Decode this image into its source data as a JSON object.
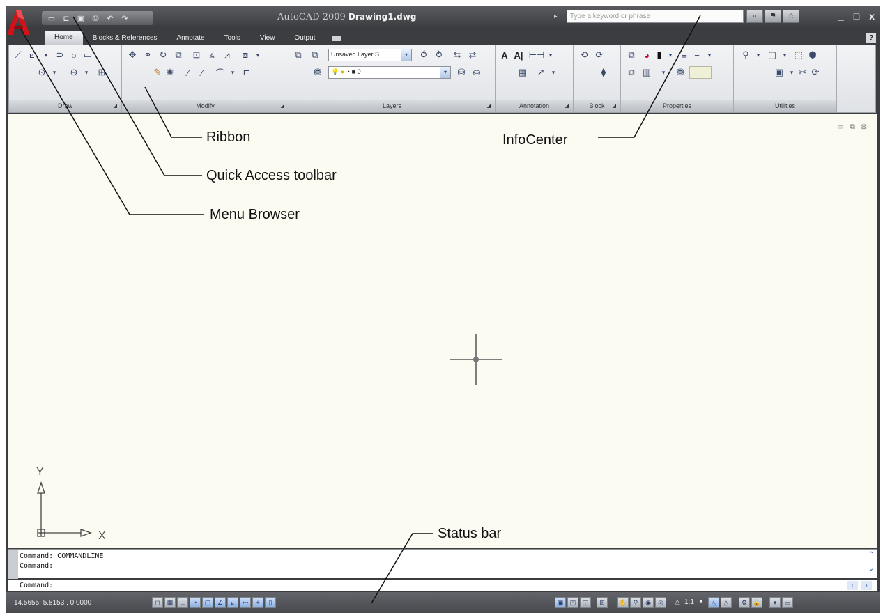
{
  "titlebar": {
    "app_name": "AutoCAD 2009",
    "doc_name": "Drawing1.dwg",
    "search_placeholder": "Type a keyword or phrase"
  },
  "tabs": [
    "Home",
    "Blocks & References",
    "Annotate",
    "Tools",
    "View",
    "Output"
  ],
  "ribbon": {
    "panels": [
      "Draw",
      "Modify",
      "Layers",
      "Annotation",
      "Block",
      "Properties",
      "Utilities"
    ],
    "layer_state": "Unsaved Layer S",
    "current_layer": "0"
  },
  "command_lines": [
    "Command: COMMANDLINE",
    "Command:",
    "Command:"
  ],
  "status": {
    "coordinates": "14.5655, 5.8153 , 0.0000",
    "annotation_scale": "1:1"
  },
  "ucs": {
    "y_label": "Y",
    "x_label": "X"
  },
  "annotations": {
    "ribbon": "Ribbon",
    "qat": "Quick Access toolbar",
    "menu_browser": "Menu Browser",
    "infocenter": "InfoCenter",
    "statusbar": "Status bar"
  },
  "colors": {
    "logo_red": "#d0131a",
    "drawing_background": "#fcfbf1",
    "frame_dark": "#3c3d40"
  },
  "icons": [
    "menu-browser-logo-icon",
    "new-icon",
    "open-icon",
    "save-icon",
    "print-icon",
    "undo-icon",
    "redo-icon",
    "search-icon",
    "crosshair-cursor-icon",
    "ucs-icon"
  ]
}
